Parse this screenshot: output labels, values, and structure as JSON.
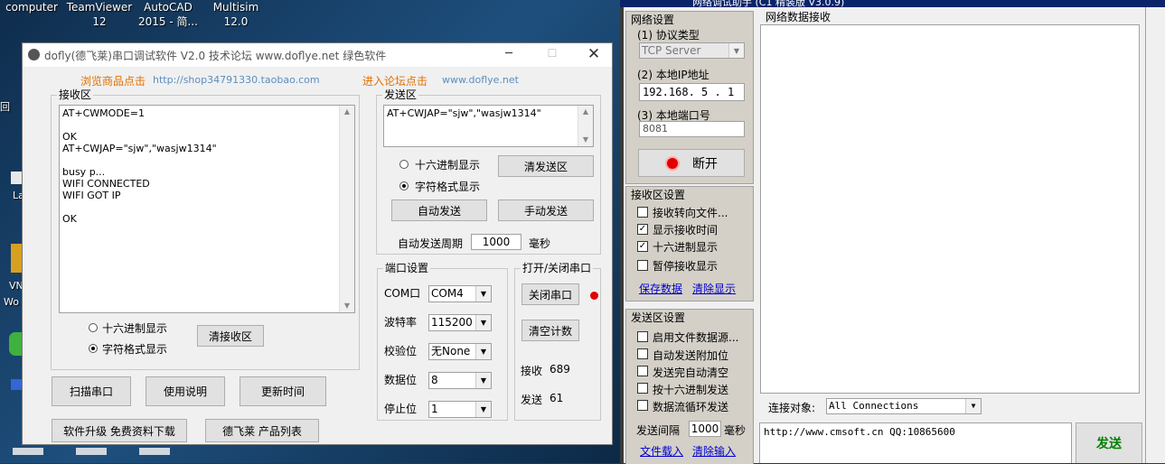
{
  "desktop": {
    "icons": [
      {
        "label": "computer",
        "label2": ""
      },
      {
        "label": "TeamViewer",
        "label2": "12"
      },
      {
        "label": "AutoCAD",
        "label2": "2015 - 简..."
      },
      {
        "label": "Multisim",
        "label2": "12.0"
      }
    ],
    "left_labels": [
      "回",
      "La",
      "VN",
      "Wo"
    ]
  },
  "serial": {
    "title": "dofly(德飞莱)串口调试软件 V2.0 技术论坛 www.doflye.net 绿色软件",
    "shop_label": "浏览商品点击",
    "shop_url": "http://shop34791330.taobao.com",
    "forum_label": "进入论坛点击",
    "forum_url": "www.doflye.net",
    "recv_title": "接收区",
    "recv_lines": [
      "AT+CWMODE=1",
      "",
      "OK",
      "AT+CWJAP=\"sjw\",\"wasjw1314\"",
      "",
      "busy p...",
      "WIFI CONNECTED",
      "WIFI GOT IP",
      "",
      "OK"
    ],
    "recv_hex": "十六进制显示",
    "recv_char": "字符格式显示",
    "clear_recv": "清接收区",
    "send_title": "发送区",
    "send_text": "AT+CWJAP=\"sjw\",\"wasjw1314\"",
    "send_hex": "十六进制显示",
    "send_char": "字符格式显示",
    "clear_send": "清发送区",
    "auto_send": "自动发送",
    "manual_send": "手动发送",
    "period_label": "自动发送周期",
    "period_value": "1000",
    "period_unit": "毫秒",
    "port_title": "端口设置",
    "port_fields": [
      {
        "label": "COM口",
        "value": "COM4"
      },
      {
        "label": "波特率",
        "value": "115200"
      },
      {
        "label": "校验位",
        "value": "无None"
      },
      {
        "label": "数据位",
        "value": "8"
      },
      {
        "label": "停止位",
        "value": "1"
      }
    ],
    "open_title": "打开/关闭串口",
    "close_port": "关闭串口",
    "clear_count": "清空计数",
    "recv_count_label": "接收",
    "recv_count": "689",
    "send_count_label": "发送",
    "send_count": "61",
    "scan": "扫描串口",
    "help": "使用说明",
    "update_time": "更新时间",
    "upgrade": "软件升级 免费资料下载",
    "products": "德飞莱 产品列表"
  },
  "net": {
    "title_partial": "网络调试助手 (C1 精装版 V3.0.9)",
    "net_settings": "网络设置",
    "proto_label": "(1) 协议类型",
    "proto_value": "TCP Server",
    "ip_label": "(2) 本地IP地址",
    "ip_parts": [
      "192.168.",
      "5",
      "1"
    ],
    "port_label": "(3) 本地端口号",
    "port_value": "8081",
    "disconnect": "断开",
    "recv_settings": "接收区设置",
    "recv_opts": [
      {
        "label": "接收转向文件...",
        "checked": false
      },
      {
        "label": "显示接收时间",
        "checked": true
      },
      {
        "label": "十六进制显示",
        "checked": true
      },
      {
        "label": "暂停接收显示",
        "checked": false
      }
    ],
    "save_data": "保存数据",
    "clear_display": "清除显示",
    "send_settings": "发送区设置",
    "send_opts": [
      {
        "label": "启用文件数据源...",
        "checked": false
      },
      {
        "label": "自动发送附加位",
        "checked": false
      },
      {
        "label": "发送完自动清空",
        "checked": false
      },
      {
        "label": "按十六进制发送",
        "checked": false
      },
      {
        "label": "数据流循环发送",
        "checked": false
      }
    ],
    "interval_label": "发送间隔",
    "interval_value": "1000",
    "interval_unit": "毫秒",
    "file_load": "文件载入",
    "clear_input": "清除输入",
    "data_recv_title": "网络数据接收",
    "conn_label": "连接对象:",
    "conn_value": "All Connections",
    "send_text": "http://www.cmsoft.cn QQ:10865600",
    "send_btn": "发送",
    "send_btn_color": "#008000"
  }
}
